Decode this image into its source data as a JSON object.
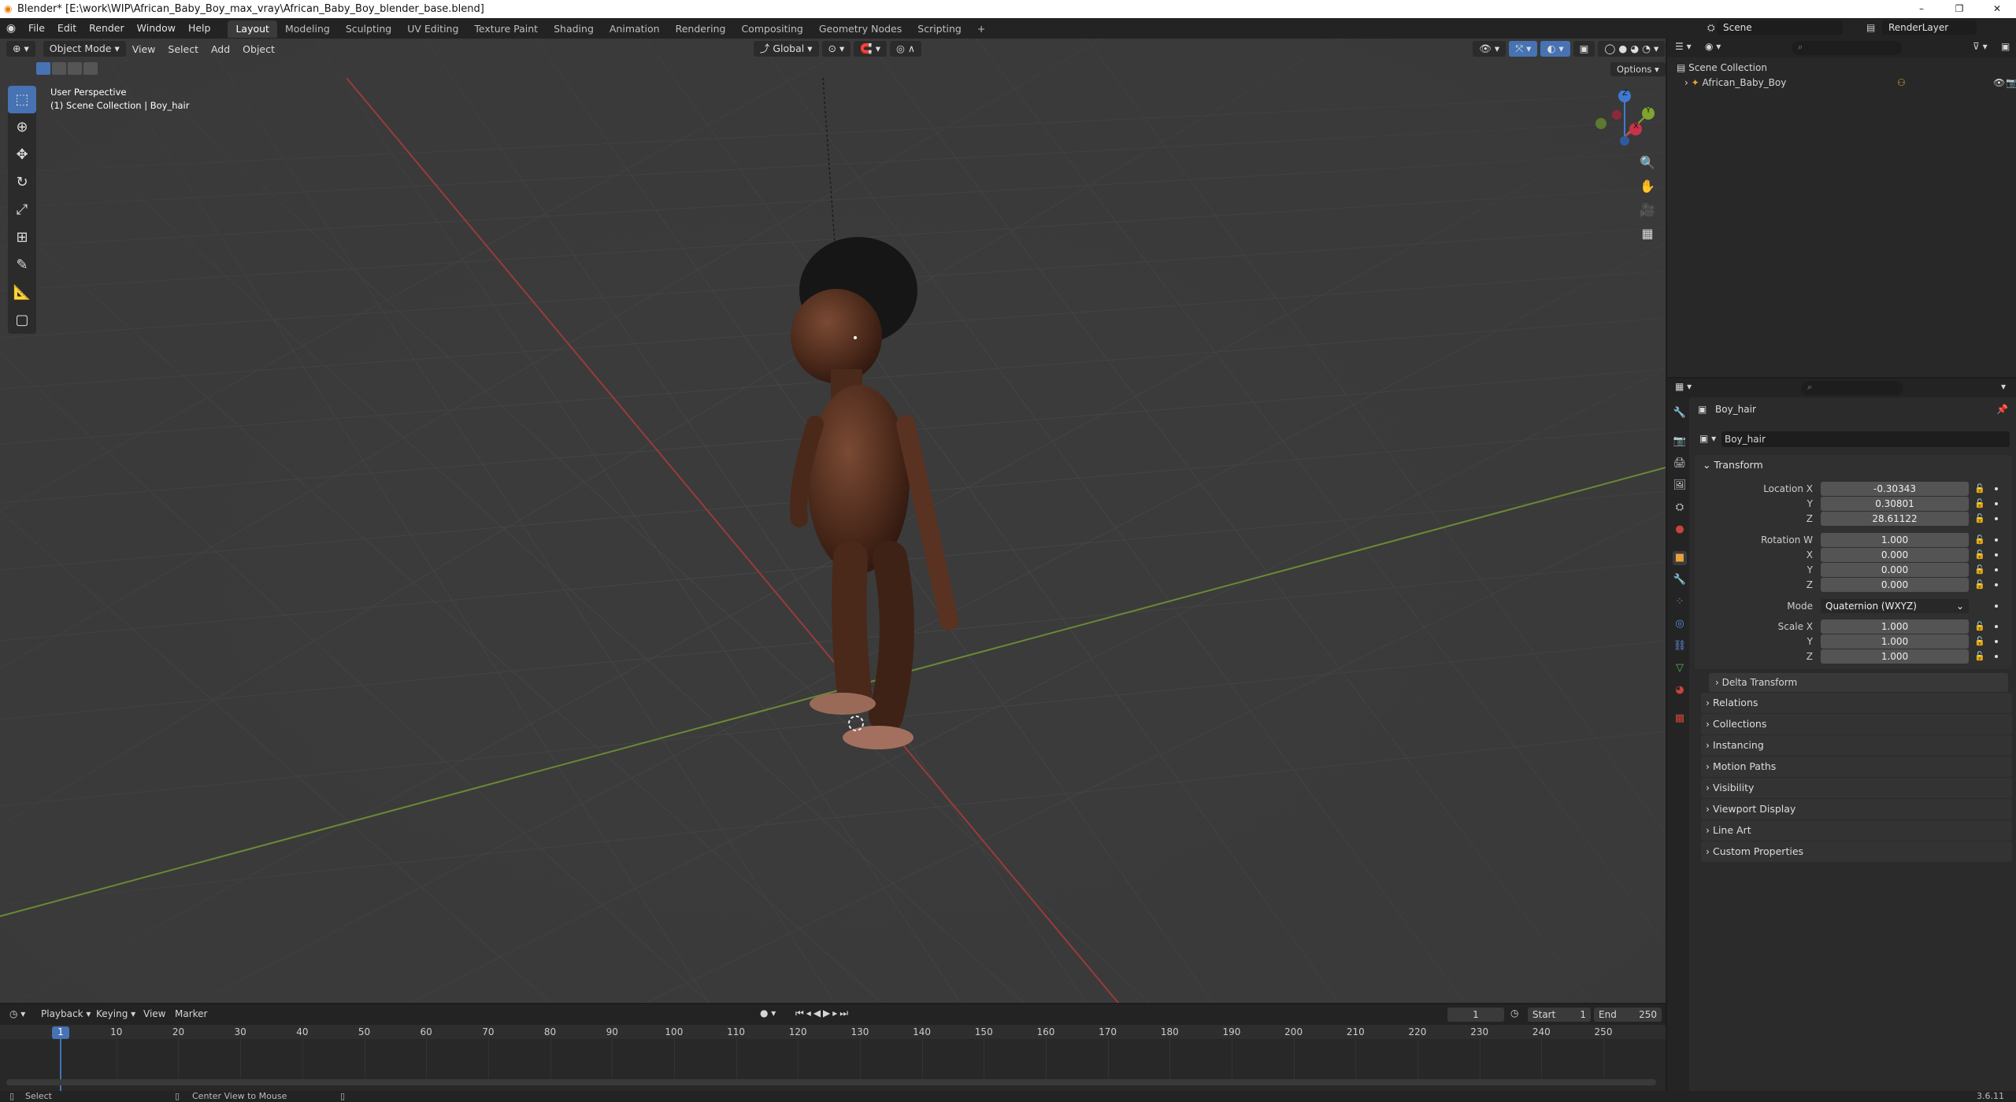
{
  "window": {
    "title": "Blender* [E:\\work\\WIP\\African_Baby_Boy_max_vray\\African_Baby_Boy_blender_base.blend]",
    "btn_min": "–",
    "btn_max": "❐",
    "btn_close": "✕"
  },
  "menu": [
    "File",
    "Edit",
    "Render",
    "Window",
    "Help"
  ],
  "workspaces": [
    "Layout",
    "Modeling",
    "Sculpting",
    "UV Editing",
    "Texture Paint",
    "Shading",
    "Animation",
    "Rendering",
    "Compositing",
    "Geometry Nodes",
    "Scripting"
  ],
  "add_workspace": "+",
  "scene": {
    "label": "Scene",
    "view_layer": "RenderLayer"
  },
  "viewport": {
    "mode": "Object Mode",
    "menus": [
      "View",
      "Select",
      "Add",
      "Object"
    ],
    "orientation": "Global",
    "options": "Options",
    "info_line1": "User Perspective",
    "info_line2": "(1) Scene Collection | Boy_hair",
    "gizmo": {
      "x": "X",
      "y": "Y",
      "z": "Z"
    }
  },
  "outliner": {
    "root": "Scene Collection",
    "items": [
      {
        "name": "African_Baby_Boy"
      }
    ]
  },
  "properties": {
    "object_name": "Boy_hair",
    "data_name": "Boy_hair",
    "transform_header": "Transform",
    "location": {
      "label": "Location X",
      "x": "-0.30343",
      "y": "0.30801",
      "z": "28.61122"
    },
    "rotation": {
      "label": "Rotation W",
      "w": "1.000",
      "x": "0.000",
      "y": "0.000",
      "z": "0.000"
    },
    "mode_label": "Mode",
    "mode_value": "Quaternion (WXYZ)",
    "scale": {
      "label": "Scale X",
      "x": "1.000",
      "y": "1.000",
      "z": "1.000"
    },
    "axis_labels": {
      "y": "Y",
      "z": "Z",
      "x": "X"
    },
    "delta": "Delta Transform",
    "panels": [
      "Relations",
      "Collections",
      "Instancing",
      "Motion Paths",
      "Visibility",
      "Viewport Display",
      "Line Art",
      "Custom Properties"
    ]
  },
  "timeline": {
    "menus": [
      "Playback",
      "Keying",
      "View",
      "Marker"
    ],
    "current_frame": "1",
    "start_label": "Start",
    "start": "1",
    "end_label": "End",
    "end": "250",
    "ruler": [
      "1",
      "10",
      "20",
      "30",
      "40",
      "50",
      "60",
      "70",
      "80",
      "90",
      "100",
      "110",
      "120",
      "130",
      "140",
      "150",
      "160",
      "170",
      "180",
      "190",
      "200",
      "210",
      "220",
      "230",
      "240",
      "250"
    ]
  },
  "status": {
    "select": "Select",
    "center": "Center View to Mouse",
    "version": "3.6.11"
  }
}
